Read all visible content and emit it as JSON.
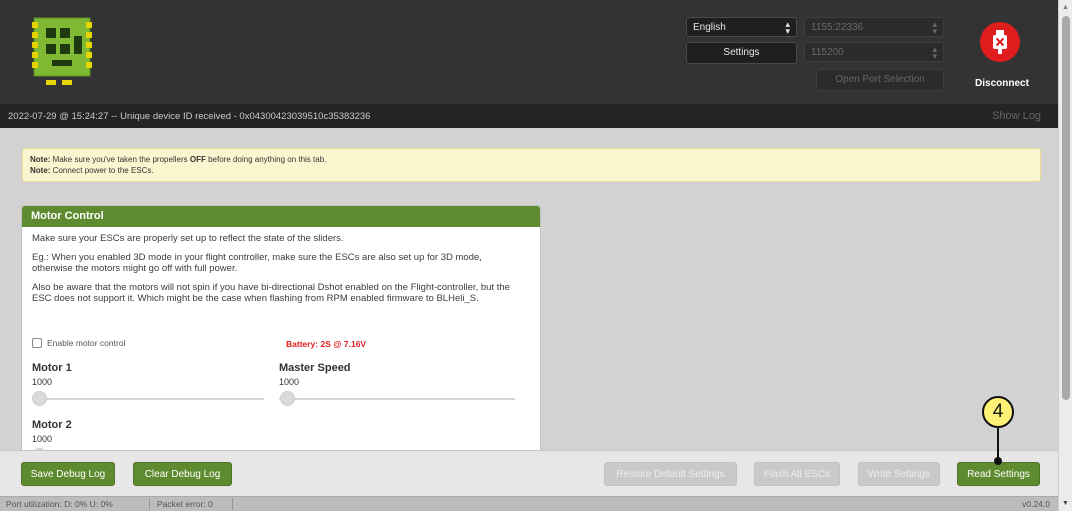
{
  "header": {
    "language_select": {
      "value": "English"
    },
    "port_select": {
      "value": "1155:22336"
    },
    "baud_select": {
      "value": "115200"
    },
    "settings_label": "Settings",
    "open_port_label": "Open Port Selection",
    "disconnect_label": "Disconnect",
    "brand_color": "#5e8b30",
    "disconnect_color": "#e01d1d"
  },
  "log": {
    "message": "2022-07-29 @ 15:24:27 -- Unique device ID received - 0x04300423039510c35383236",
    "show_log_label": "Show Log"
  },
  "notes": [
    {
      "bold": "Note:",
      "pre": " Make sure you've taken the propellers ",
      "emph": "OFF",
      "post": " before doing anything on this tab."
    },
    {
      "bold": "Note:",
      "pre": " Connect power to the ESCs.",
      "emph": "",
      "post": ""
    }
  ],
  "motor_control": {
    "title": "Motor Control",
    "paragraphs": [
      "Make sure your ESCs are properly set up to reflect the state of the sliders.",
      "Eg.: When you enabled 3D mode in your flight controller, make sure the ESCs are also set up for 3D mode, otherwise the motors might go off with full power.",
      "Also be aware that the motors will not spin if you have bi-directional Dshot enabled on the Flight-controller, but the ESC does not support it. Which might be the case when flashing from RPM enabled firmware to BLHeli_S."
    ],
    "enable_label": "Enable motor control",
    "enable_checked": false,
    "battery_text": "Battery: 2S @ 7.16V",
    "sliders": {
      "motor1": {
        "label": "Motor 1",
        "value": "1000"
      },
      "master": {
        "label": "Master Speed",
        "value": "1000"
      },
      "motor2": {
        "label": "Motor 2",
        "value": "1000"
      }
    }
  },
  "toolbar": {
    "save_debug_log": "Save Debug Log",
    "clear_debug_log": "Clear Debug Log",
    "restore_defaults": "Restore Default Settings",
    "flash_all": "Flash All ESCs",
    "write_settings": "Write Settings",
    "read_settings": "Read Settings"
  },
  "status": {
    "port_util": "Port utilization: D: 0% U: 0%",
    "packet_error": "Packet error: 0",
    "version": "v0.24.0"
  },
  "annotation": {
    "number": "4"
  }
}
